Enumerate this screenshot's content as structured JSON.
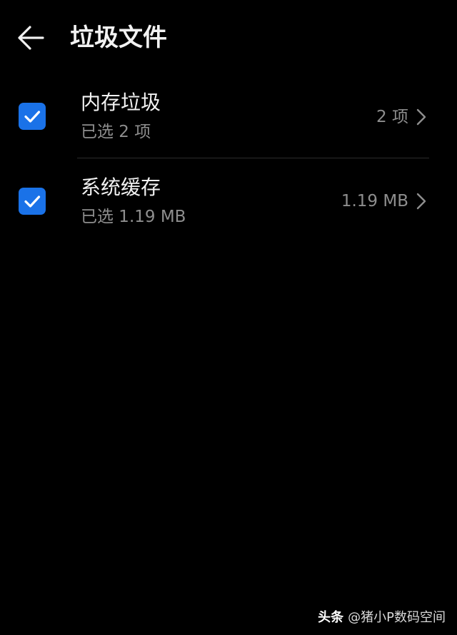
{
  "header": {
    "back_icon": "arrow-left-icon",
    "title": "垃圾文件"
  },
  "items": [
    {
      "title": "内存垃圾",
      "subtitle": "已选 2 项",
      "value": "2 项",
      "checked": true,
      "check_icon": "checkmark-icon",
      "chevron_icon": "chevron-right-icon"
    },
    {
      "title": "系统缓存",
      "subtitle": "已选 1.19 MB",
      "value": "1.19 MB",
      "checked": true,
      "check_icon": "checkmark-icon",
      "chevron_icon": "chevron-right-icon"
    }
  ],
  "watermark": {
    "brand": "头条",
    "handle": "@猪小P数码空间"
  },
  "colors": {
    "background": "#000000",
    "accent": "#1a72e8",
    "primary_text": "#f2f2f2",
    "secondary_text": "#8e8e8e",
    "divider": "#2c2c2c"
  }
}
